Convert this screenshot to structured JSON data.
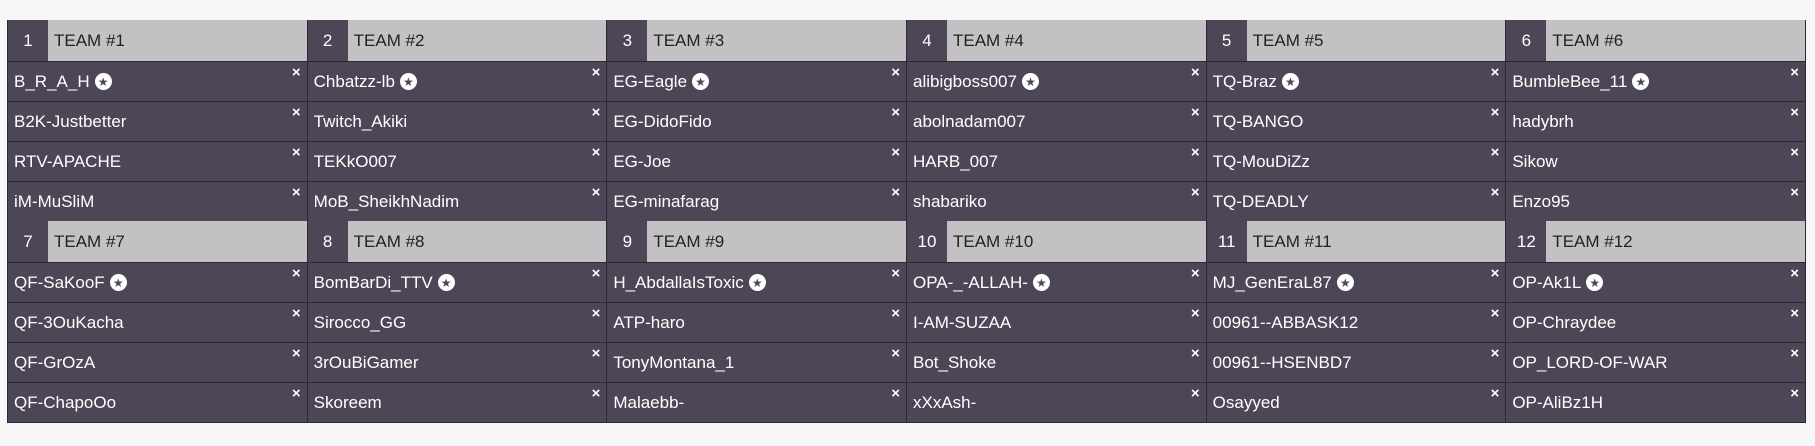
{
  "teams": [
    {
      "number": "1",
      "name": "TEAM #1",
      "players": [
        "B_R_A_H",
        "B2K-Justbetter",
        "RTV-APACHE",
        "iM-MuSliM"
      ]
    },
    {
      "number": "2",
      "name": "TEAM #2",
      "players": [
        "Chbatzz-lb",
        "Twitch_Akiki",
        "TEKkO007",
        "MoB_SheikhNadim"
      ]
    },
    {
      "number": "3",
      "name": "TEAM #3",
      "players": [
        "EG-Eagle",
        "EG-DidoFido",
        "EG-Joe",
        "EG-minafarag"
      ]
    },
    {
      "number": "4",
      "name": "TEAM #4",
      "players": [
        "alibigboss007",
        "abolnadam007",
        "HARB_007",
        "shabariko"
      ]
    },
    {
      "number": "5",
      "name": "TEAM #5",
      "players": [
        "TQ-Braz",
        "TQ-BANGO",
        "TQ-MouDiZz",
        "TQ-DEADLY"
      ]
    },
    {
      "number": "6",
      "name": "TEAM #6",
      "players": [
        "BumbleBee_11",
        "hadybrh",
        "Sikow",
        "Enzo95"
      ]
    },
    {
      "number": "7",
      "name": "TEAM #7",
      "players": [
        "QF-SaKooF",
        "QF-3OuKacha",
        "QF-GrOzA",
        "QF-ChapoOo"
      ]
    },
    {
      "number": "8",
      "name": "TEAM #8",
      "players": [
        "BomBarDi_TTV",
        "Sirocco_GG",
        "3rOuBiGamer",
        "Skoreem"
      ]
    },
    {
      "number": "9",
      "name": "TEAM #9",
      "players": [
        "H_AbdallaIsToxic",
        "ATP-haro",
        "TonyMontana_1",
        "Malaebb-"
      ]
    },
    {
      "number": "10",
      "name": "TEAM #10",
      "players": [
        "OPA-_-ALLAH-",
        "I-AM-SUZAA",
        "Bot_Shoke",
        "xXxAsh-"
      ]
    },
    {
      "number": "11",
      "name": "TEAM #11",
      "players": [
        "MJ_GenEraL87",
        "00961--ABBASK12",
        "00961--HSENBD7",
        "Osayyed"
      ]
    },
    {
      "number": "12",
      "name": "TEAM #12",
      "players": [
        "OP-Ak1L",
        "OP-Chraydee",
        "OP_LORD-OF-WAR",
        "OP-AliBz1H"
      ]
    }
  ],
  "captain_icon": "star-badge-icon",
  "remove_icon": "close-icon",
  "remove_glyph": "×",
  "star_glyph": "★",
  "colors": {
    "header_bg": "#c3c1c4",
    "number_bg": "#4c4656",
    "row_bg": "#4c4656",
    "border": "#2c2836",
    "page_bg": "#f7f7f8"
  }
}
